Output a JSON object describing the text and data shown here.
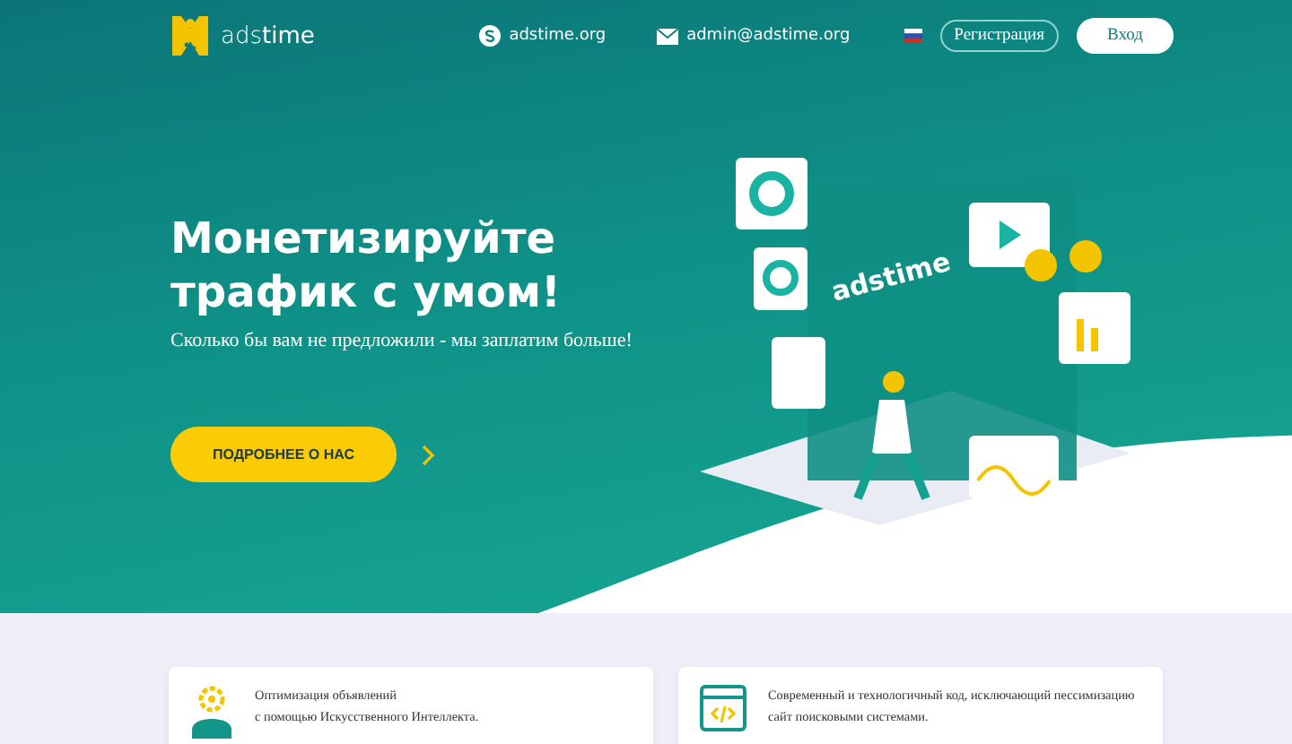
{
  "header": {
    "logo": "ads**time**",
    "skype": "adstime.org",
    "email": "admin@adstime.org",
    "register": "Регистрация",
    "login": "Вход"
  },
  "hero": {
    "title_lines": [
      "Монетизируйте",
      "трафик с умом!"
    ],
    "subtitle": "Сколько бы вам не предложили - мы заплатим больше!",
    "button": "ПОДРОБНЕЕ О НАС",
    "illustration_text": "adstime"
  },
  "features": [
    {
      "kind": "gear",
      "lines": [
        "Оптимизация объявлений",
        "с помощью Искусственного Интеллекта."
      ]
    },
    {
      "kind": "code",
      "lines": [
        "Современный и технологичный код, исключающий пессимизацию",
        "сайт поисковыми системами."
      ]
    }
  ]
}
